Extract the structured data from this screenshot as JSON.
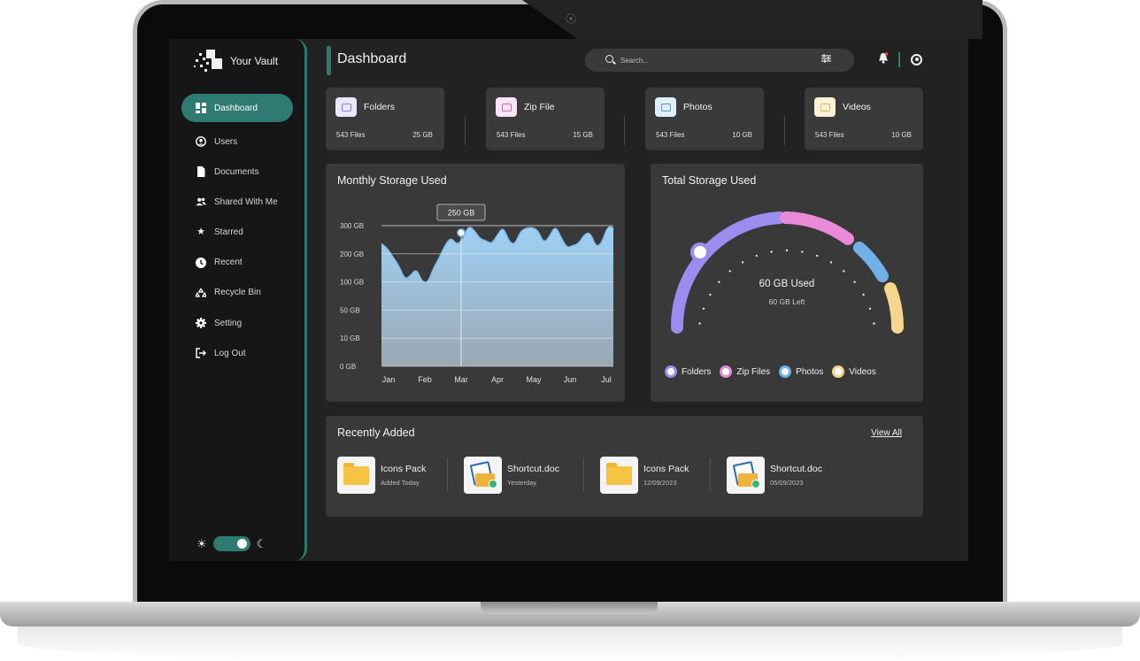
{
  "app": {
    "brand": "Your Vault"
  },
  "sidebar": {
    "items": [
      {
        "label": "Dashboard",
        "icon": "dashboard-icon",
        "active": true
      },
      {
        "label": "Users",
        "icon": "users-icon"
      },
      {
        "label": "Documents",
        "icon": "document-icon"
      },
      {
        "label": "Shared With Me",
        "icon": "shared-users-icon"
      },
      {
        "label": "Starred",
        "icon": "star-icon"
      },
      {
        "label": "Recent",
        "icon": "clock-icon"
      },
      {
        "label": "Recycle Bin",
        "icon": "recycle-icon"
      },
      {
        "label": "Setting",
        "icon": "gear-icon"
      },
      {
        "label": "Log Out",
        "icon": "logout-icon"
      }
    ],
    "theme_toggle": {
      "mode": "dark"
    }
  },
  "header": {
    "title": "Dashboard",
    "search_placeholder": "Search..."
  },
  "categories": [
    {
      "name": "Folders",
      "files": "543 Files",
      "size": "25 GB",
      "color": "#9b8cf0"
    },
    {
      "name": "Zip File",
      "files": "543 Files",
      "size": "15 GB",
      "color": "#e88ad8"
    },
    {
      "name": "Photos",
      "files": "543 Files",
      "size": "10 GB",
      "color": "#6fb1e8"
    },
    {
      "name": "Videos",
      "files": "543 Files",
      "size": "10 GB",
      "color": "#f6d58c"
    }
  ],
  "monthly": {
    "title": "Monthly Storage Used",
    "tooltip": "250 GB"
  },
  "chart_data": {
    "type": "area",
    "title": "Monthly Storage Used",
    "categories": [
      "Jan",
      "Feb",
      "Mar",
      "Apr",
      "May",
      "Jun",
      "Jul"
    ],
    "y_ticks": [
      "300 GB",
      "200 GB",
      "100 GB",
      "50 GB",
      "10 GB",
      "0 GB"
    ],
    "values": [
      5.2,
      3.6,
      5.9,
      5.6,
      6.0,
      5.4,
      5.9
    ],
    "highlight": {
      "category": "Mar",
      "label": "250 GB"
    }
  },
  "total": {
    "title": "Total Storage Used",
    "used": "60 GB Used",
    "left": "60 GB Left",
    "legend": [
      {
        "label": "Folders",
        "color": "#9b8cf0"
      },
      {
        "label": "Zip Files",
        "color": "#e88ad8"
      },
      {
        "label": "Photos",
        "color": "#6fb1e8"
      },
      {
        "label": "Videos",
        "color": "#f6d58c"
      }
    ]
  },
  "recent": {
    "title": "Recently Added",
    "view_all": "View All",
    "items": [
      {
        "name": "Icons Pack",
        "date": "Added Today",
        "type": "folder"
      },
      {
        "name": "Shortcut.doc",
        "date": "Yesterday",
        "type": "doc"
      },
      {
        "name": "Icons Pack",
        "date": "12/09/2023",
        "type": "folder"
      },
      {
        "name": "Shortcut.doc",
        "date": "05/09/2023",
        "type": "doc"
      }
    ]
  }
}
